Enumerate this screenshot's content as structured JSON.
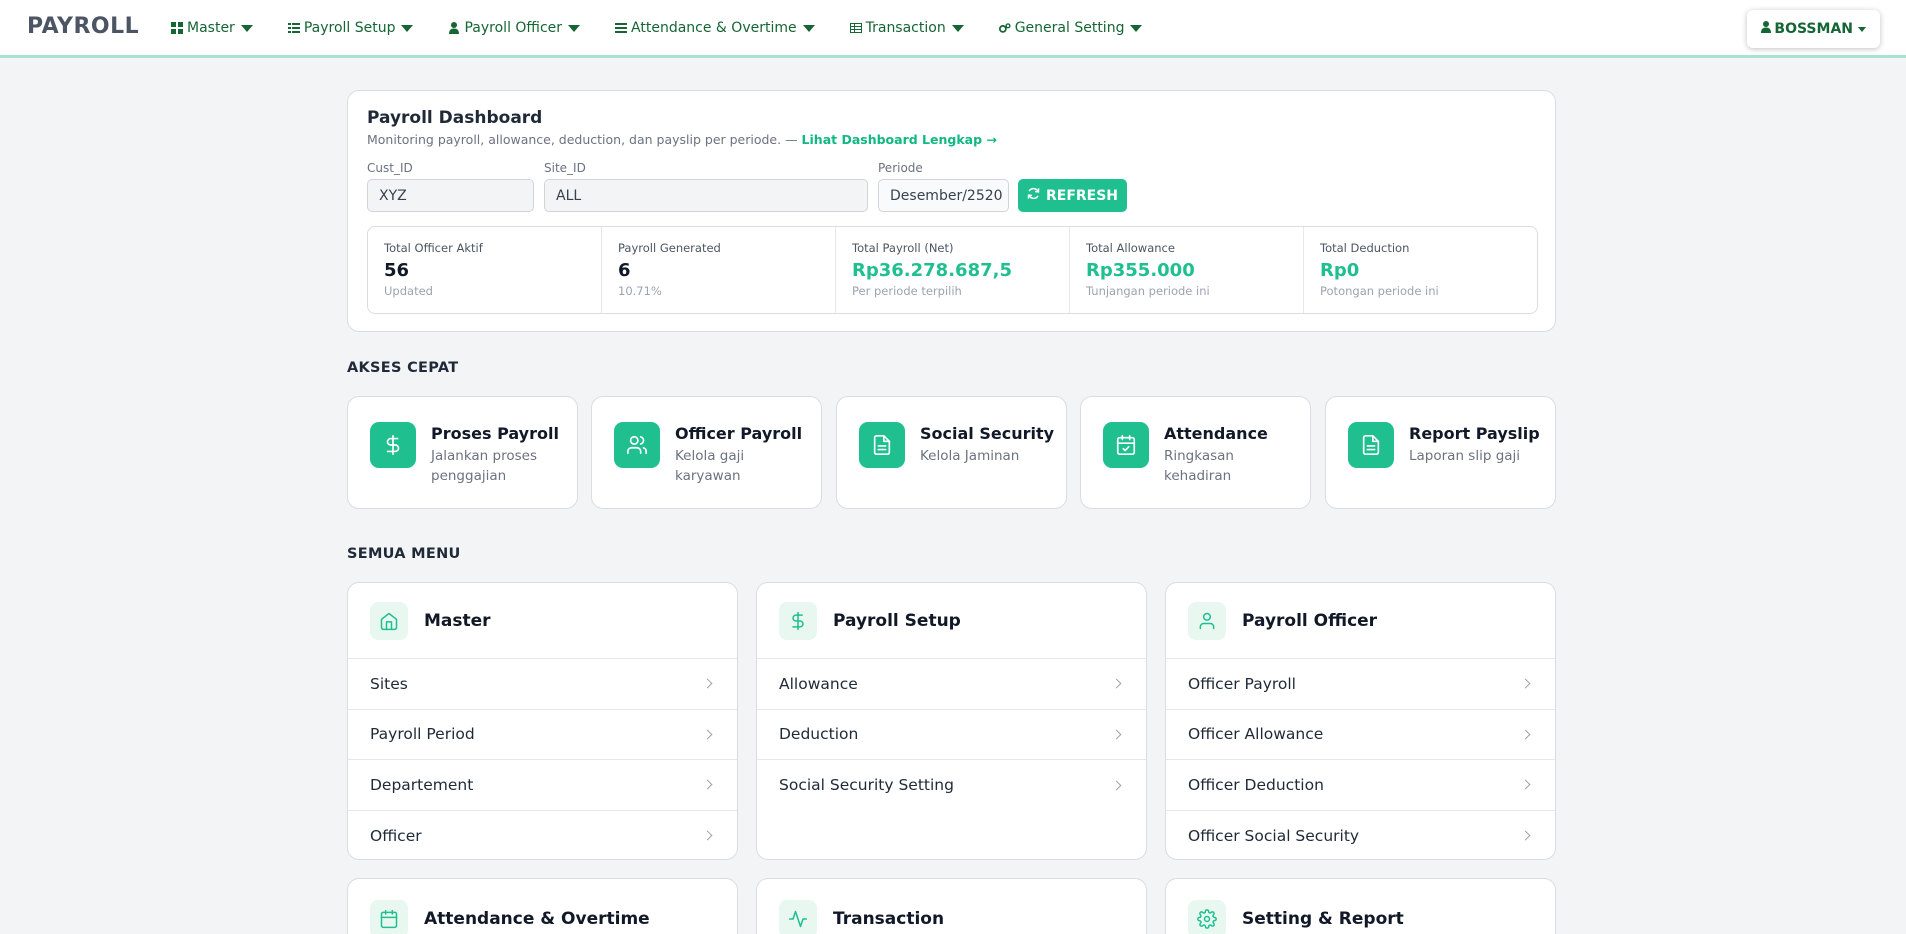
{
  "navbar": {
    "brand": "PAYROLL",
    "items": [
      {
        "label": "Master",
        "icon": "grid-icon"
      },
      {
        "label": "Payroll Setup",
        "icon": "list-icon"
      },
      {
        "label": "Payroll Officer",
        "icon": "person-icon"
      },
      {
        "label": "Attendance & Overtime",
        "icon": "tasks-icon"
      },
      {
        "label": "Transaction",
        "icon": "table-icon"
      },
      {
        "label": "General Setting",
        "icon": "gears-icon"
      }
    ],
    "user": "BOSSMAN"
  },
  "dashboard": {
    "title": "Payroll Dashboard",
    "subtitle": "Monitoring payroll, allowance, deduction, dan payslip per periode. — ",
    "link": "Lihat Dashboard Lengkap →",
    "fields": {
      "cust_label": "Cust_ID",
      "cust_value": "XYZ",
      "site_label": "Site_ID",
      "site_value": "ALL",
      "periode_label": "Periode",
      "periode_value": "Desember/2520"
    },
    "refresh_label": "REFRESH",
    "stats": [
      {
        "label": "Total Officer Aktif",
        "value": "56",
        "note": "Updated",
        "accent": false
      },
      {
        "label": "Payroll Generated",
        "value": "6",
        "note": "10.71%",
        "accent": false
      },
      {
        "label": "Total Payroll (Net)",
        "value": "Rp36.278.687,5",
        "note": "Per periode terpilih",
        "accent": true
      },
      {
        "label": "Total Allowance",
        "value": "Rp355.000",
        "note": "Tunjangan periode ini",
        "accent": true
      },
      {
        "label": "Total Deduction",
        "value": "Rp0",
        "note": "Potongan periode ini",
        "accent": true
      }
    ]
  },
  "quick_access": {
    "title": "AKSES CEPAT",
    "items": [
      {
        "title": "Proses Payroll",
        "desc": "Jalankan proses penggajian",
        "icon": "dollar-icon"
      },
      {
        "title": "Officer Payroll",
        "desc": "Kelola gaji karyawan",
        "icon": "users-icon"
      },
      {
        "title": "Social Security",
        "desc": "Kelola Jaminan",
        "icon": "document-icon"
      },
      {
        "title": "Attendance",
        "desc": "Ringkasan kehadiran",
        "icon": "calendar-check-icon"
      },
      {
        "title": "Report Payslip",
        "desc": "Laporan slip gaji",
        "icon": "document-icon"
      }
    ]
  },
  "all_menu": {
    "title": "SEMUA MENU",
    "cards": [
      {
        "title": "Master",
        "icon": "home-icon",
        "items": [
          "Sites",
          "Payroll Period",
          "Departement",
          "Officer"
        ]
      },
      {
        "title": "Payroll Setup",
        "icon": "dollar-icon",
        "items": [
          "Allowance",
          "Deduction",
          "Social Security Setting"
        ]
      },
      {
        "title": "Payroll Officer",
        "icon": "user-icon",
        "items": [
          "Officer Payroll",
          "Officer Allowance",
          "Officer Deduction",
          "Officer Social Security"
        ]
      },
      {
        "title": "Attendance & Overtime",
        "icon": "calendar-icon",
        "items": []
      },
      {
        "title": "Transaction",
        "icon": "activity-icon",
        "items": []
      },
      {
        "title": "Setting & Report",
        "icon": "gear-icon",
        "items": []
      }
    ]
  },
  "colors": {
    "accent": "#1fbf8f",
    "nav_text": "#166534"
  }
}
